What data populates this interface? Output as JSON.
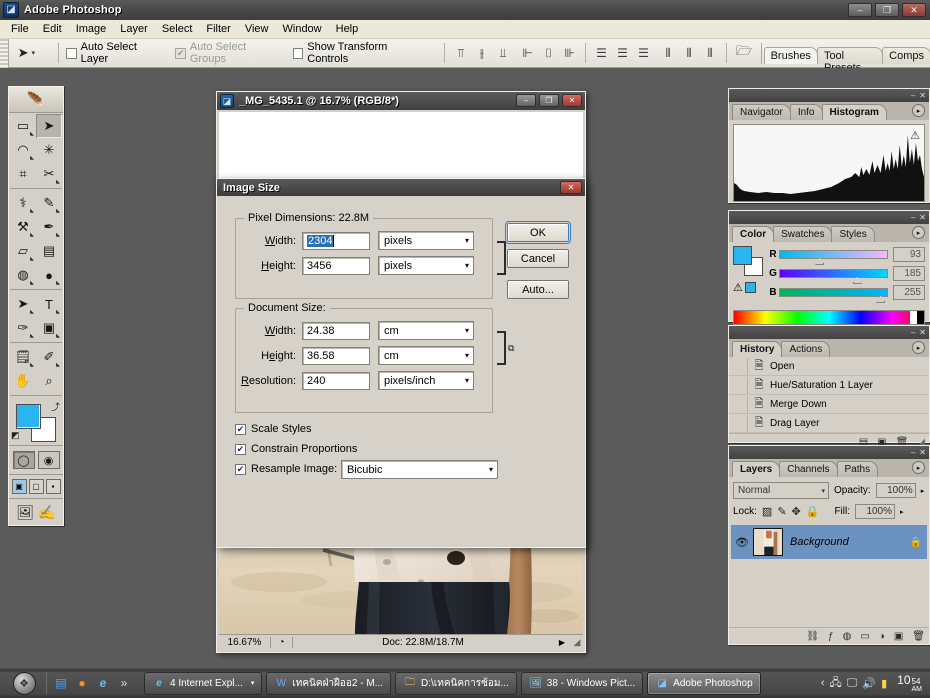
{
  "window": {
    "title": "Adobe Photoshop",
    "app_icon": "photoshop-icon",
    "minimize": "–",
    "maximize": "❐",
    "close": "✕"
  },
  "menubar": {
    "items": [
      {
        "label": "File"
      },
      {
        "label": "Edit"
      },
      {
        "label": "Image"
      },
      {
        "label": "Layer"
      },
      {
        "label": "Select"
      },
      {
        "label": "Filter"
      },
      {
        "label": "View"
      },
      {
        "label": "Window"
      },
      {
        "label": "Help"
      }
    ]
  },
  "options_bar": {
    "tool_glyph": "➤",
    "tool_caret": "▾",
    "checkboxes": [
      {
        "label": "Auto Select Layer",
        "checked": false,
        "enabled": true
      },
      {
        "label": "Auto Select Groups",
        "checked": true,
        "enabled": false
      },
      {
        "label": "Show Transform Controls",
        "checked": false,
        "enabled": true
      }
    ],
    "align_group_1": [
      "align-top-edges",
      "align-vertical-centers",
      "align-bottom-edges"
    ],
    "align_group_2": [
      "align-left-edges",
      "align-horizontal-centers",
      "align-right-edges"
    ],
    "distribute_group_1": [
      "distribute-top-edges",
      "distribute-vertical-centers",
      "distribute-bottom-edges"
    ],
    "distribute_group_2": [
      "distribute-left-edges",
      "distribute-horizontal-centers",
      "distribute-right-edges"
    ],
    "palette_well": {
      "toggle_icon": "file-browser-icon",
      "tabs": [
        {
          "label": "Brushes",
          "active": true
        },
        {
          "label": "Tool Presets",
          "active": false
        },
        {
          "label": "Comps",
          "active": false
        }
      ]
    }
  },
  "toolbox": {
    "header_icon": "photoshop-feather-logo",
    "tools": [
      {
        "name": "rectangular-marquee-tool",
        "glyph": "▭",
        "selected": false
      },
      {
        "name": "move-tool",
        "glyph": "➤",
        "selected": true
      },
      {
        "name": "lasso-tool",
        "glyph": "✧",
        "selected": false
      },
      {
        "name": "magic-wand-tool",
        "glyph": "✳",
        "selected": false
      },
      {
        "name": "crop-tool",
        "glyph": "⌗",
        "selected": false
      },
      {
        "name": "slice-tool",
        "glyph": "✂",
        "selected": false
      },
      {
        "name": "healing-brush-tool",
        "glyph": "⚕",
        "selected": false
      },
      {
        "name": "brush-tool",
        "glyph": "✎",
        "selected": false
      },
      {
        "name": "clone-stamp-tool",
        "glyph": "⚒",
        "selected": false
      },
      {
        "name": "history-brush-tool",
        "glyph": "✒",
        "selected": false
      },
      {
        "name": "eraser-tool",
        "glyph": "▱",
        "selected": false
      },
      {
        "name": "gradient-tool",
        "glyph": "▤",
        "selected": false
      },
      {
        "name": "blur-tool",
        "glyph": "◍",
        "selected": false
      },
      {
        "name": "dodge-tool",
        "glyph": "●",
        "selected": false
      },
      {
        "name": "path-selection-tool",
        "glyph": "➤",
        "selected": false
      },
      {
        "name": "type-tool",
        "glyph": "T",
        "selected": false
      },
      {
        "name": "pen-tool",
        "glyph": "✑",
        "selected": false
      },
      {
        "name": "rectangle-tool",
        "glyph": "▣",
        "selected": false
      },
      {
        "name": "notes-tool",
        "glyph": "▤",
        "selected": false
      },
      {
        "name": "eyedropper-tool",
        "glyph": "✐",
        "selected": false
      },
      {
        "name": "hand-tool",
        "glyph": "✋",
        "selected": false
      },
      {
        "name": "zoom-tool",
        "glyph": "⌕",
        "selected": false
      }
    ],
    "foreground_color": "#29b6f0",
    "background_color": "#ffffff",
    "swap_icon": "swap-colors-icon",
    "default_icon": "default-colors-icon",
    "mode_buttons": [
      {
        "name": "standard-mask-mode",
        "glyph": "◯",
        "active": true
      },
      {
        "name": "quick-mask-mode",
        "glyph": "◉",
        "active": false
      }
    ],
    "screen_modes": [
      {
        "name": "standard-screen-mode",
        "glyph": "▣",
        "active": true
      },
      {
        "name": "full-screen-with-menubar",
        "glyph": "▢",
        "active": false
      },
      {
        "name": "full-screen-mode",
        "glyph": "▪",
        "active": false
      }
    ],
    "jump_to_imageready": "⇨",
    "jump_icon_2": "✍"
  },
  "document": {
    "title": "_MG_5435.1 @ 16.7% (RGB/8*)",
    "icon": "document-icon",
    "minimize": "–",
    "maximize": "❐",
    "close": "✕",
    "status": {
      "zoom": "16.67%",
      "preview_icon": "preview-icon",
      "doc_info": "Doc: 22.8M/18.7M",
      "arrow": "▶",
      "resize_grip": "◢"
    }
  },
  "image_size_dialog": {
    "title": "Image Size",
    "close": "✕",
    "pixel_dimensions": {
      "legend": "Pixel Dimensions:  22.8M",
      "width_label": "Width:",
      "width_value": "2304",
      "width_unit": "pixels",
      "height_label": "Height:",
      "height_value": "3456",
      "height_unit": "pixels",
      "link_icon": "chain-link-icon"
    },
    "document_size": {
      "legend": "Document Size:",
      "width_label": "Width:",
      "width_value": "24.38",
      "width_unit": "cm",
      "height_label": "Height:",
      "height_value": "36.58",
      "height_unit": "cm",
      "resolution_label": "Resolution:",
      "resolution_value": "240",
      "resolution_unit": "pixels/inch",
      "link_icon": "chain-link-icon"
    },
    "checkboxes": [
      {
        "label": "Scale Styles",
        "checked": true
      },
      {
        "label": "Constrain Proportions",
        "checked": true
      },
      {
        "label": "Resample Image:",
        "checked": true
      }
    ],
    "resample_method": "Bicubic",
    "buttons": [
      {
        "label": "OK",
        "default": true
      },
      {
        "label": "Cancel",
        "default": false
      },
      {
        "label": "Auto...",
        "default": false
      }
    ],
    "dropdown_arrow": "▾",
    "check_glyph": "✔"
  },
  "palettes": {
    "histogram_group": {
      "tabs": [
        {
          "label": "Navigator",
          "active": false
        },
        {
          "label": "Info",
          "active": false
        },
        {
          "label": "Histogram",
          "active": true
        }
      ],
      "warning_icon": "cached-data-warning-icon",
      "menu_icon": "palette-menu-icon",
      "minimize": "–",
      "close": "✕"
    },
    "color_group": {
      "tabs": [
        {
          "label": "Color",
          "active": true
        },
        {
          "label": "Swatches",
          "active": false
        },
        {
          "label": "Styles",
          "active": false
        }
      ],
      "menu_icon": "palette-menu-icon",
      "minimize": "–",
      "close": "✕",
      "out_of_gamut_icon": "gamut-warning-icon",
      "channels": [
        {
          "label": "R",
          "value": "93"
        },
        {
          "label": "G",
          "value": "185"
        },
        {
          "label": "B",
          "value": "255"
        }
      ],
      "foreground_color": "#29b6f0",
      "background_color": "#ffffff"
    },
    "history_group": {
      "tabs": [
        {
          "label": "History",
          "active": true
        },
        {
          "label": "Actions",
          "active": false
        }
      ],
      "menu_icon": "palette-menu-icon",
      "minimize": "–",
      "close": "✕",
      "items": [
        {
          "label": "Open",
          "icon": "history-state-icon"
        },
        {
          "label": "Hue/Saturation 1 Layer",
          "icon": "history-state-icon"
        },
        {
          "label": "Merge Down",
          "icon": "history-state-icon"
        },
        {
          "label": "Drag Layer",
          "icon": "history-state-icon"
        }
      ],
      "footer_icons": [
        {
          "name": "create-document-from-state-icon",
          "glyph": "▤"
        },
        {
          "name": "create-new-snapshot-icon",
          "glyph": "▣"
        },
        {
          "name": "delete-state-icon",
          "glyph": "🗑"
        }
      ]
    },
    "layers_group": {
      "tabs": [
        {
          "label": "Layers",
          "active": true
        },
        {
          "label": "Channels",
          "active": false
        },
        {
          "label": "Paths",
          "active": false
        }
      ],
      "menu_icon": "palette-menu-icon",
      "minimize": "–",
      "close": "✕",
      "blend_mode": "Normal",
      "opacity_label": "Opacity:",
      "opacity_value": "100%",
      "lock_label": "Lock:",
      "lock_icons": [
        {
          "name": "lock-transparent-pixels-icon",
          "glyph": "▨"
        },
        {
          "name": "lock-image-pixels-icon",
          "glyph": "✎"
        },
        {
          "name": "lock-position-icon",
          "glyph": "✥"
        },
        {
          "name": "lock-all-icon",
          "glyph": "🔒"
        }
      ],
      "fill_label": "Fill:",
      "fill_value": "100%",
      "layers": [
        {
          "name": "Background",
          "visible": true,
          "locked": true,
          "eye_icon": "eye-icon",
          "lock_icon": "lock-icon"
        }
      ],
      "footer_icons": [
        {
          "name": "link-layers-icon",
          "glyph": "⛓"
        },
        {
          "name": "add-layer-style-icon",
          "glyph": "ƒ"
        },
        {
          "name": "add-layer-mask-icon",
          "glyph": "◍"
        },
        {
          "name": "new-group-icon",
          "glyph": "▭"
        },
        {
          "name": "new-adjustment-layer-icon",
          "glyph": "◑"
        },
        {
          "name": "new-layer-icon",
          "glyph": "▣"
        },
        {
          "name": "delete-layer-icon",
          "glyph": "🗑"
        }
      ]
    }
  },
  "taskbar": {
    "start_label": "start",
    "start_icon": "windows-orb-icon",
    "quick_launch": [
      {
        "name": "notepad-quicklaunch-icon",
        "glyph": "▤"
      },
      {
        "name": "firefox-quicklaunch-icon",
        "glyph": "●"
      },
      {
        "name": "internet-explorer-quicklaunch-icon",
        "glyph": "e"
      },
      {
        "name": "quicklaunch-overflow-icon",
        "glyph": "»"
      }
    ],
    "tasks": [
      {
        "label": "4 Internet Expl...",
        "icon": "internet-explorer-icon",
        "active": false,
        "group": true,
        "group_arrow": "▾"
      },
      {
        "label": "เทคนิคฝ่าฝืออ2 - M...",
        "icon": "word-icon",
        "active": false
      },
      {
        "label": "D:\\เทคนิคการซ้อม...",
        "icon": "folder-icon",
        "active": false
      },
      {
        "label": "38 - Windows Pict...",
        "icon": "picture-viewer-icon",
        "active": false
      },
      {
        "label": "Adobe Photoshop",
        "icon": "photoshop-icon",
        "active": true
      }
    ],
    "tray": {
      "expand_arrow": "‹",
      "icons": [
        {
          "name": "network-tray-icon",
          "glyph": "🖧"
        },
        {
          "name": "display-tray-icon",
          "glyph": "🖵"
        },
        {
          "name": "volume-tray-icon",
          "glyph": "🔊"
        },
        {
          "name": "printer-tray-icon",
          "glyph": "🖶"
        }
      ],
      "clock_hour": "10",
      "clock_minutes": "54",
      "clock_ampm": "AM"
    }
  }
}
